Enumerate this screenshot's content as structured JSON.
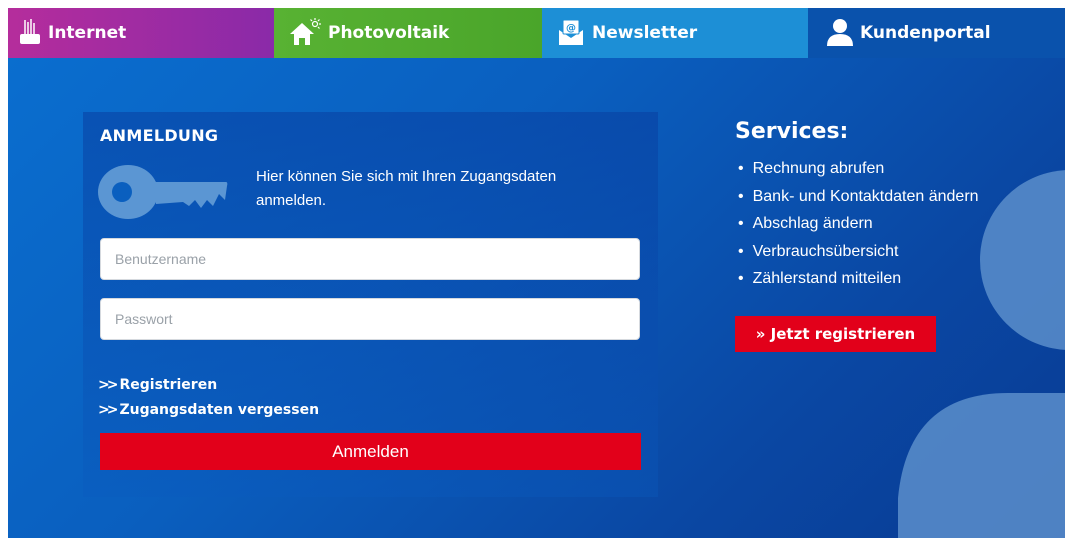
{
  "nav": {
    "internet": "Internet",
    "photovoltaik": "Photovoltaik",
    "newsletter": "Newsletter",
    "kundenportal": "Kundenportal"
  },
  "login": {
    "title": "ANMELDUNG",
    "intro": "Hier können Sie sich mit Ihren Zugangsdaten anmelden.",
    "username_placeholder": "Benutzername",
    "password_placeholder": "Passwort",
    "register_link": "Registrieren",
    "forgot_link": "Zugangsdaten vergessen",
    "submit": "Anmelden"
  },
  "services": {
    "title": "Services:",
    "items": [
      "Rechnung abrufen",
      "Bank- und Kontaktdaten ändern",
      "Abschlag ändern",
      "Verbrauchsübersicht",
      "Zählerstand mitteilen"
    ],
    "register_button": "» Jetzt registrieren"
  },
  "colors": {
    "accent_red": "#e2001a",
    "internet_tab": "#b52d9c",
    "photovoltaik_tab": "#58b233",
    "newsletter_tab": "#1d8fd6",
    "kundenportal_tab": "#0a52ac",
    "background_blue": "#0a5fbf"
  },
  "icons": {
    "internet": "fiber-cable-icon",
    "photovoltaik": "house-sun-icon",
    "newsletter": "envelope-at-icon",
    "kundenportal": "user-icon",
    "login": "key-icon"
  }
}
